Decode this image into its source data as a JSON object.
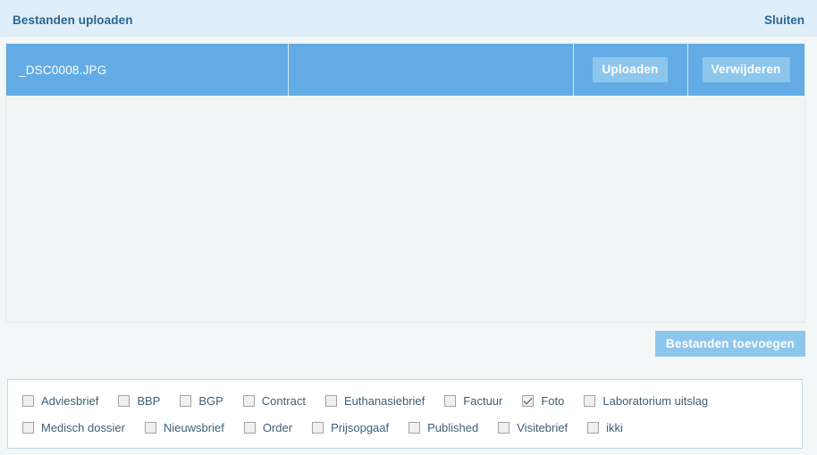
{
  "header": {
    "title": "Bestanden uploaden",
    "close_label": "Sluiten"
  },
  "file_list": {
    "rows": [
      {
        "filename": "_DSC0008.JPG",
        "upload_label": "Uploaden",
        "delete_label": "Verwijderen"
      }
    ]
  },
  "actions": {
    "add_files_label": "Bestanden toevoegen"
  },
  "tags": {
    "row1": [
      {
        "label": "Adviesbrief",
        "checked": false
      },
      {
        "label": "BBP",
        "checked": false
      },
      {
        "label": "BGP",
        "checked": false
      },
      {
        "label": "Contract",
        "checked": false
      },
      {
        "label": "Euthanasiebrief",
        "checked": false
      },
      {
        "label": "Factuur",
        "checked": false
      },
      {
        "label": "Foto",
        "checked": true
      },
      {
        "label": "Laboratorium uitslag",
        "checked": false
      }
    ],
    "row2": [
      {
        "label": "Medisch dossier",
        "checked": false
      },
      {
        "label": "Nieuwsbrief",
        "checked": false
      },
      {
        "label": "Order",
        "checked": false
      },
      {
        "label": "Prijsopgaaf",
        "checked": false
      },
      {
        "label": "Published",
        "checked": false
      },
      {
        "label": "Visitebrief",
        "checked": false
      },
      {
        "label": "ikki",
        "checked": false
      }
    ]
  },
  "colors": {
    "header_bg": "#dfeef8",
    "header_text": "#2b6591",
    "row_bg": "#62abe4",
    "button_bg": "#8dc6ec",
    "panel_bg": "#f2f5f5",
    "tags_border": "#bcd9ea"
  }
}
